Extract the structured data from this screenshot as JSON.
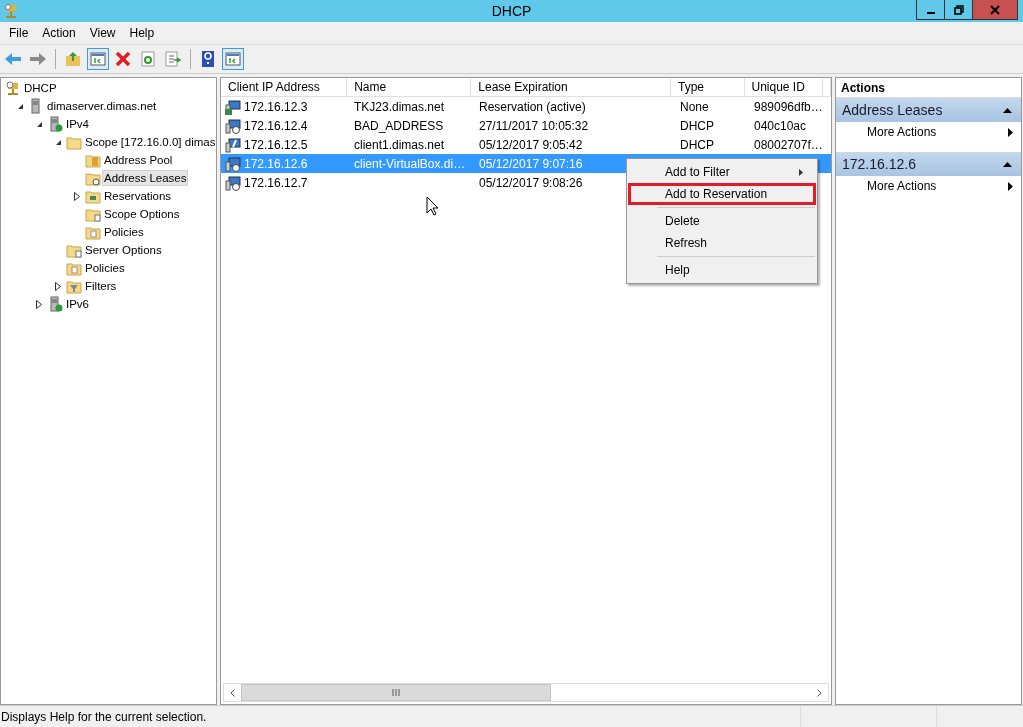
{
  "window": {
    "title": "DHCP"
  },
  "menu": [
    "File",
    "Action",
    "View",
    "Help"
  ],
  "toolbar": [
    [
      {
        "kind": "back",
        "pressed": false
      },
      {
        "kind": "forward",
        "pressed": false
      }
    ],
    [
      {
        "kind": "up",
        "pressed": false
      },
      {
        "kind": "tree",
        "pressed": true
      },
      {
        "kind": "delete",
        "pressed": false
      },
      {
        "kind": "refresh",
        "pressed": false
      },
      {
        "kind": "export",
        "pressed": false
      }
    ],
    [
      {
        "kind": "help",
        "pressed": false
      },
      {
        "kind": "pane",
        "pressed": true
      }
    ]
  ],
  "tree": [
    {
      "label": "DHCP",
      "kind": "root",
      "selected": false,
      "children": [
        {
          "label": "dimaserver.dimas.net",
          "kind": "server",
          "expanded": true,
          "selected": false,
          "children": [
            {
              "label": "IPv4",
              "kind": "protocol",
              "expanded": true,
              "selected": false,
              "children": [
                {
                  "label": "Scope [172.16.0.0] dimas",
                  "kind": "folder",
                  "expanded": true,
                  "selected": false,
                  "children": [
                    {
                      "label": "Address Pool",
                      "kind": "pool",
                      "selected": false
                    },
                    {
                      "label": "Address Leases",
                      "kind": "leases",
                      "selected": true
                    },
                    {
                      "label": "Reservations",
                      "kind": "reservations",
                      "expanded": false,
                      "selected": false
                    },
                    {
                      "label": "Scope Options",
                      "kind": "options",
                      "selected": false
                    },
                    {
                      "label": "Policies",
                      "kind": "policies",
                      "selected": false
                    }
                  ]
                },
                {
                  "label": "Server Options",
                  "kind": "options",
                  "selected": false
                },
                {
                  "label": "Policies",
                  "kind": "policies",
                  "selected": false
                },
                {
                  "label": "Filters",
                  "kind": "filters",
                  "expanded": false,
                  "selected": false
                }
              ]
            },
            {
              "label": "IPv6",
              "kind": "protocol",
              "expanded": false,
              "selected": false
            }
          ]
        }
      ]
    }
  ],
  "table": {
    "columns": [
      "Client IP Address",
      "Name",
      "Lease Expiration",
      "Type",
      "Unique ID"
    ],
    "rows": [
      {
        "kind": "reservation",
        "selected": false,
        "cells": [
          "172.16.12.3",
          "TKJ23.dimas.net",
          "Reservation (active)",
          "None",
          "989096dfb…"
        ]
      },
      {
        "kind": "lease",
        "selected": false,
        "cells": [
          "172.16.12.4",
          "BAD_ADDRESS",
          "27/11/2017 10:05:32",
          "DHCP",
          "040c10ac"
        ]
      },
      {
        "kind": "active",
        "selected": false,
        "cells": [
          "172.16.12.5",
          "client1.dimas.net",
          "05/12/2017 9:05:42",
          "DHCP",
          "08002707f…"
        ]
      },
      {
        "kind": "lease",
        "selected": true,
        "cells": [
          "172.16.12.6",
          "client-VirtualBox.di…",
          "05/12/2017 9:07:16"
        ]
      },
      {
        "kind": "lease",
        "selected": false,
        "cells": [
          "172.16.12.7",
          "",
          "05/12/2017 9:08:26"
        ]
      }
    ]
  },
  "context_menu": [
    [
      {
        "label": "Add to Filter",
        "submenu": true,
        "highlighted": false
      },
      {
        "label": "Add to Reservation",
        "submenu": false,
        "highlighted": true
      }
    ],
    [
      {
        "label": "Delete",
        "submenu": false,
        "highlighted": false
      },
      {
        "label": "Refresh",
        "submenu": false,
        "highlighted": false
      }
    ],
    [
      {
        "label": "Help",
        "submenu": false,
        "highlighted": false
      }
    ]
  ],
  "actions": {
    "title": "Actions",
    "sections": [
      {
        "title": "Address Leases",
        "items": [
          "More Actions"
        ]
      },
      {
        "title": "172.16.12.6",
        "items": [
          "More Actions"
        ]
      }
    ]
  },
  "status_bar": "Displays Help for the current selection."
}
